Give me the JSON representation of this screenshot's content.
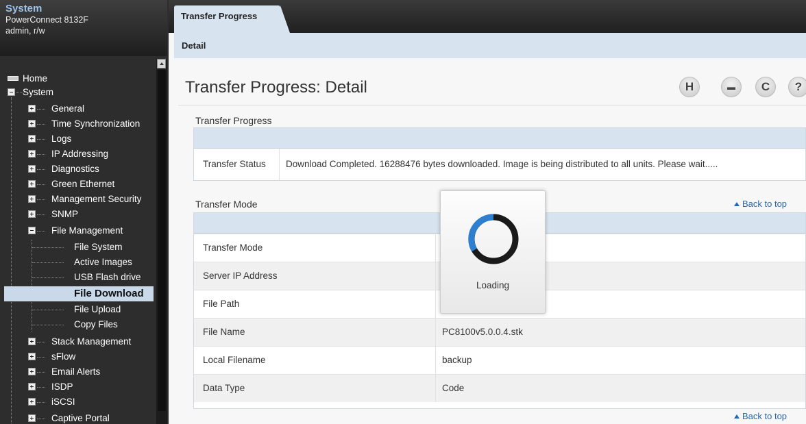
{
  "system": {
    "title": "System",
    "model": "PowerConnect 8132F",
    "user": "admin, r/w"
  },
  "nav": {
    "items": [
      {
        "label": "Home"
      },
      {
        "label": "System"
      },
      {
        "label": "General"
      },
      {
        "label": "Time Synchronization"
      },
      {
        "label": "Logs"
      },
      {
        "label": "IP Addressing"
      },
      {
        "label": "Diagnostics"
      },
      {
        "label": "Green Ethernet"
      },
      {
        "label": "Management Security"
      },
      {
        "label": "SNMP"
      },
      {
        "label": "File Management"
      },
      {
        "label": "File System"
      },
      {
        "label": "Active Images"
      },
      {
        "label": "USB Flash drive"
      },
      {
        "label": "File Download"
      },
      {
        "label": "File Upload"
      },
      {
        "label": "Copy Files"
      },
      {
        "label": "Stack Management"
      },
      {
        "label": "sFlow"
      },
      {
        "label": "Email Alerts"
      },
      {
        "label": "ISDP"
      },
      {
        "label": "iSCSI"
      },
      {
        "label": "Captive Portal"
      }
    ]
  },
  "tabs": {
    "main": "Transfer Progress",
    "sub": "Detail"
  },
  "page": {
    "title": "Transfer Progress: Detail"
  },
  "toolbar": {
    "save_icon": "H",
    "print_icon": "▬",
    "refresh_icon": "C",
    "help_icon": "?"
  },
  "sections": {
    "progress": {
      "label": "Transfer Progress",
      "status_key": "Transfer Status",
      "status_value": "Download Completed. 16288476 bytes downloaded. Image is being distributed to all units. Please wait....."
    },
    "mode": {
      "label": "Transfer Mode",
      "back_to_top": "Back to top",
      "rows": [
        {
          "key": "Transfer Mode",
          "value": ""
        },
        {
          "key": "Server IP Address",
          "value": ""
        },
        {
          "key": "File Path",
          "value": ""
        },
        {
          "key": "File Name",
          "value": "PC8100v5.0.0.4.stk"
        },
        {
          "key": "Local Filename",
          "value": "backup"
        },
        {
          "key": "Data Type",
          "value": "Code"
        }
      ],
      "back_to_top_bottom": "Back to top"
    }
  },
  "loading": {
    "text": "Loading"
  },
  "colors": {
    "accent_blue": "#2a66b0",
    "header_band": "#d7e3ef",
    "selected_nav": "#c9d9ea"
  }
}
